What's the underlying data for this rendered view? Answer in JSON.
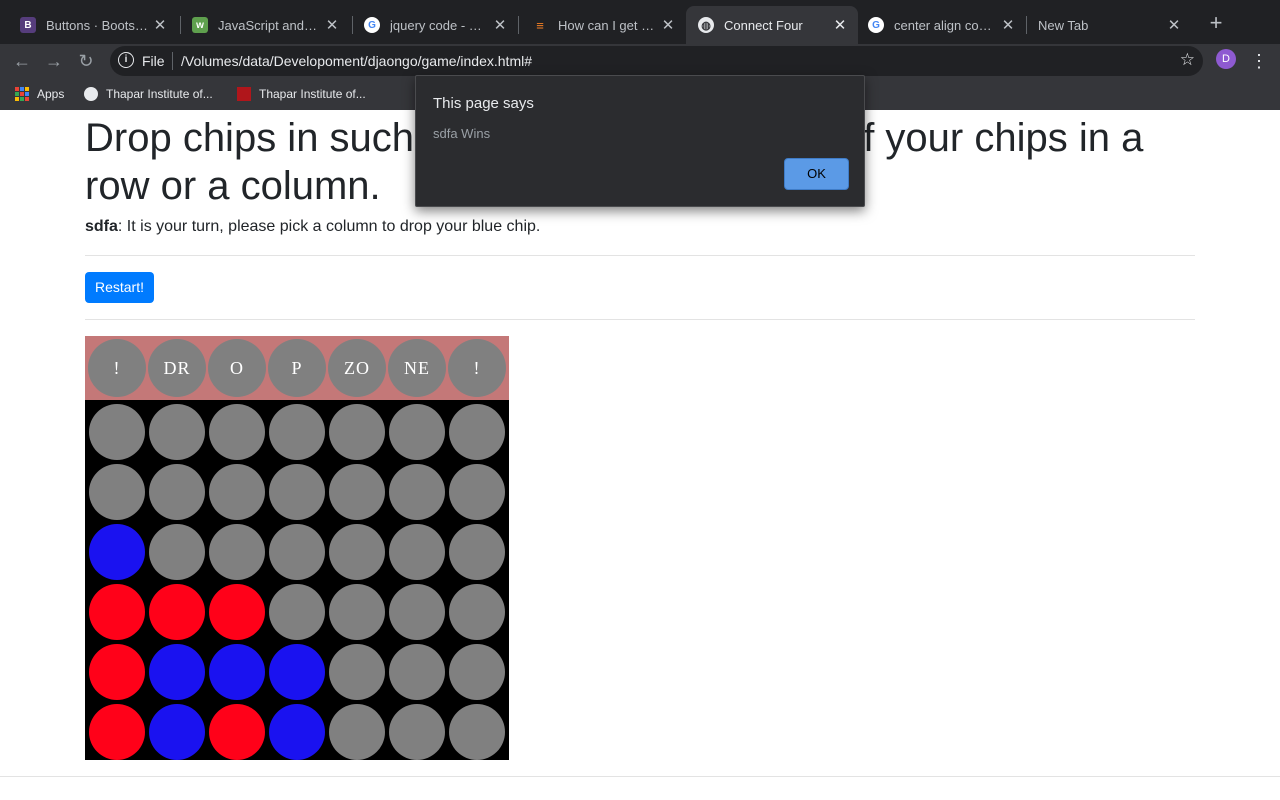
{
  "browser": {
    "tabs": [
      {
        "title": "Buttons · Bootstrap",
        "favicon": "B",
        "color": "#563d7c",
        "active": false
      },
      {
        "title": "JavaScript and HTML",
        "favicon": "w",
        "color": "#5fa04e",
        "active": false
      },
      {
        "title": "jquery code - Google",
        "favicon": "G",
        "color": "#ffffff",
        "active": false
      },
      {
        "title": "How can I get the",
        "favicon": "so",
        "color": "#f48024",
        "active": false
      },
      {
        "title": "Connect Four",
        "favicon": "globe",
        "color": "#e8eaed",
        "active": true
      },
      {
        "title": "center align conta",
        "favicon": "G",
        "color": "#ffffff",
        "active": false
      },
      {
        "title": "New Tab",
        "favicon": "",
        "color": "",
        "active": false
      }
    ],
    "address": {
      "scheme": "File",
      "url": "/Volumes/data/Developoment/djaongo/game/index.html#"
    },
    "profile_initial": "D",
    "bookmarks": [
      {
        "label": "Apps",
        "icon": "apps-grid-icon"
      },
      {
        "label": "Thapar Institute of...",
        "icon": "globe-icon"
      },
      {
        "label": "Thapar Institute of...",
        "icon": "ti-logo-icon"
      }
    ]
  },
  "page": {
    "headline": "Drop chips in such a way that you get four of your chips in a row or a column.",
    "status_player": "sdfa",
    "status_text": ": It is your turn, please pick a column to drop your blue chip.",
    "restart_label": "Restart!",
    "drop_zone_labels": [
      "!",
      "DR",
      "O",
      "P",
      "ZO",
      "NE",
      "!"
    ],
    "board": [
      [
        "gray",
        "gray",
        "gray",
        "gray",
        "gray",
        "gray",
        "gray"
      ],
      [
        "gray",
        "gray",
        "gray",
        "gray",
        "gray",
        "gray",
        "gray"
      ],
      [
        "blue",
        "gray",
        "gray",
        "gray",
        "gray",
        "gray",
        "gray"
      ],
      [
        "red",
        "red",
        "red",
        "gray",
        "gray",
        "gray",
        "gray"
      ],
      [
        "red",
        "blue",
        "blue",
        "blue",
        "gray",
        "gray",
        "gray"
      ],
      [
        "red",
        "blue",
        "red",
        "blue",
        "gray",
        "gray",
        "gray"
      ]
    ],
    "chip_colors": {
      "gray": "#808080",
      "blue": "#1a12f0",
      "red": "#ff0119"
    }
  },
  "dialog": {
    "title": "This page says",
    "message": "sdfa Wins",
    "ok_label": "OK"
  }
}
